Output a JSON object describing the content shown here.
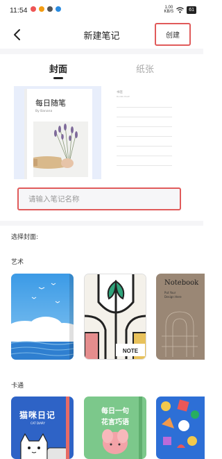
{
  "status_bar": {
    "time": "11:54",
    "net_speed_value": "1.00",
    "net_speed_unit": "KB/S",
    "battery": "61"
  },
  "header": {
    "title": "新建笔记",
    "create_label": "创建"
  },
  "tabs": {
    "cover": "封面",
    "paper": "纸张"
  },
  "preview": {
    "book_title": "每日随笔",
    "book_author": "By Banana",
    "paper_title": "书签",
    "paper_subtitle": "BLANK PAGE"
  },
  "name_input": {
    "placeholder": "请输入笔记名称"
  },
  "choose_cover_label": "选择封面:",
  "sections": {
    "art": {
      "label": "艺术",
      "covers": [
        {
          "name": "sky-sea"
        },
        {
          "name": "geometric",
          "text": "NOTE"
        },
        {
          "name": "notebook-brown",
          "title": "Notebook",
          "subtitle_1": "Put Your",
          "subtitle_2": "Design Here"
        }
      ]
    },
    "cartoon": {
      "label": "卡通",
      "covers": [
        {
          "name": "cat-diary",
          "title": "猫咪日记",
          "subtitle": "CAT DIARY"
        },
        {
          "name": "flower-words",
          "title_1": "每日一句",
          "title_2": "花言巧语"
        },
        {
          "name": "colorful-dots"
        }
      ]
    }
  },
  "colors": {
    "highlight_border": "#e05a5a",
    "sky_blue": "#4aa8ea",
    "notebook_brown": "#9a8775",
    "cat_diary_blue": "#2e63c6",
    "flower_green": "#7cc88b",
    "dots_blue": "#2d6fd6"
  }
}
